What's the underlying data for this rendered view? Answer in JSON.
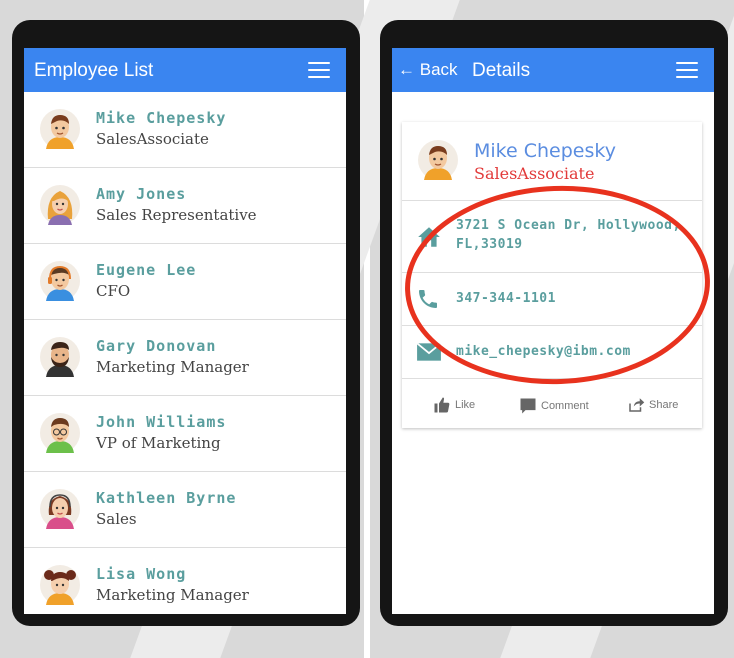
{
  "left_screen": {
    "title": "Employee List",
    "employees": [
      {
        "name": "Mike Chepesky",
        "role": "SalesAssociate"
      },
      {
        "name": "Amy Jones",
        "role": "Sales Representative"
      },
      {
        "name": "Eugene Lee",
        "role": "CFO"
      },
      {
        "name": "Gary Donovan",
        "role": "Marketing Manager"
      },
      {
        "name": "John Williams",
        "role": "VP of Marketing"
      },
      {
        "name": "Kathleen Byrne",
        "role": "Sales"
      },
      {
        "name": "Lisa Wong",
        "role": "Marketing Manager"
      }
    ]
  },
  "right_screen": {
    "back_label": "Back",
    "title": "Details",
    "employee": {
      "name": "Mike Chepesky",
      "role": "SalesAssociate"
    },
    "address": "3721 S Ocean Dr, Hollywood, FL,33019",
    "phone": "347-344-1101",
    "email": "mike_chepesky@ibm.com",
    "actions": {
      "like": "Like",
      "comment": "Comment",
      "share": "Share"
    }
  },
  "colors": {
    "app_bar": "#3a85f0",
    "name_teal": "#5a9e9e",
    "detail_name_blue": "#5b8de0",
    "detail_role_red": "#e23a3a",
    "annotation_red": "#e8321e"
  }
}
